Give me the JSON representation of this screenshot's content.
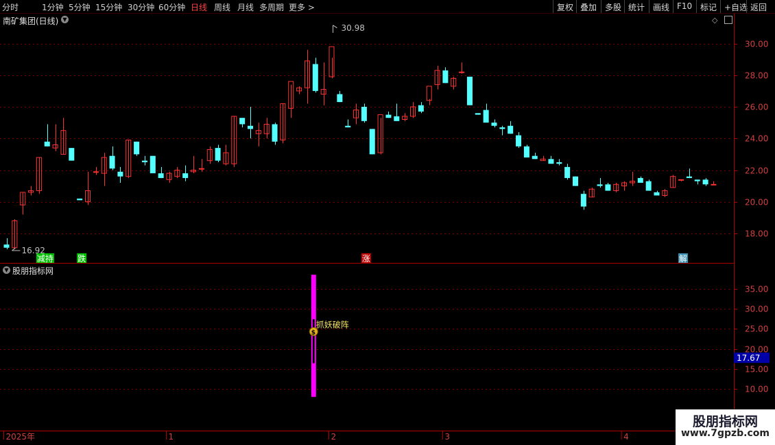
{
  "toolbar": {
    "periods": [
      {
        "label": "分时",
        "active": false
      },
      {
        "label": "1分钟",
        "active": false
      },
      {
        "label": "5分钟",
        "active": false
      },
      {
        "label": "15分钟",
        "active": false
      },
      {
        "label": "30分钟",
        "active": false
      },
      {
        "label": "60分钟",
        "active": false
      },
      {
        "label": "日线",
        "active": true
      },
      {
        "label": "周线",
        "active": false
      },
      {
        "label": "月线",
        "active": false
      },
      {
        "label": "多周期",
        "active": false
      },
      {
        "label": "更多 >",
        "active": false
      }
    ],
    "actions": [
      "复权",
      "叠加",
      "多股",
      "统计",
      "画线",
      "F10",
      "标记",
      "+自选",
      "返回"
    ]
  },
  "main_panel": {
    "title": "南矿集团(日线)",
    "high_label": "30.98",
    "low_label": "16.92",
    "signals": [
      {
        "text": "减持",
        "color": "#00c000",
        "bar": 4
      },
      {
        "text": "跌",
        "color": "#00c000",
        "bar": 9
      },
      {
        "text": "涨",
        "color": "#c00000",
        "bar": 44
      },
      {
        "text": "解",
        "color": "#3a8fb0",
        "bar": 83
      }
    ]
  },
  "indicator_panel": {
    "title": "股朋指标网",
    "signal_label": "抓妖破阵",
    "signal_badge": "$",
    "current_value": "17.67"
  },
  "time_axis": {
    "labels": [
      {
        "text": "2025年",
        "bar": 0
      },
      {
        "text": "1",
        "bar": 20
      },
      {
        "text": "2",
        "bar": 40
      },
      {
        "text": "3",
        "bar": 54
      },
      {
        "text": "4",
        "bar": 76
      }
    ]
  },
  "watermark": {
    "title": "股朋指标网",
    "url": "www.7gpzb.com"
  },
  "colors": {
    "up": "#ff3232",
    "down": "#54ffff",
    "axis": "#b00000",
    "grid": "#7a0000",
    "indicator": "#ff00ff"
  },
  "chart_data": [
    {
      "type": "candlestick",
      "title": "南矿集团(日线)",
      "y_ticks": [
        18.0,
        20.0,
        22.0,
        24.0,
        26.0,
        28.0,
        30.0
      ],
      "ylim": [
        16.4,
        31.9
      ],
      "ohlc": [
        [
          17.3,
          17.7,
          17.0,
          17.1
        ],
        [
          17.1,
          18.9,
          17.0,
          18.8
        ],
        [
          19.8,
          20.6,
          19.2,
          20.6
        ],
        [
          20.6,
          21.0,
          20.4,
          20.7
        ],
        [
          20.7,
          22.8,
          20.5,
          22.8
        ],
        [
          23.8,
          24.9,
          23.5,
          23.5
        ],
        [
          23.4,
          24.9,
          23.2,
          23.6
        ],
        [
          23.0,
          25.3,
          23.0,
          24.5
        ],
        [
          23.4,
          23.4,
          22.6,
          22.6
        ],
        [
          20.2,
          20.2,
          20.1,
          20.1
        ],
        [
          20.0,
          21.9,
          19.8,
          20.7
        ],
        [
          21.9,
          22.2,
          21.7,
          21.9
        ],
        [
          21.8,
          23.1,
          21.0,
          22.8
        ],
        [
          22.9,
          23.5,
          22.0,
          22.1
        ],
        [
          21.9,
          22.2,
          21.2,
          21.6
        ],
        [
          21.6,
          23.9,
          21.5,
          23.9
        ],
        [
          23.8,
          23.8,
          22.9,
          23.0
        ],
        [
          22.6,
          22.9,
          22.3,
          22.5
        ],
        [
          22.9,
          22.9,
          21.9,
          21.8
        ],
        [
          21.8,
          22.2,
          21.5,
          21.5
        ],
        [
          21.4,
          21.9,
          21.2,
          21.8
        ],
        [
          21.6,
          22.2,
          21.5,
          22.0
        ],
        [
          21.8,
          22.3,
          21.3,
          21.5
        ],
        [
          21.9,
          22.9,
          21.8,
          22.0
        ],
        [
          22.1,
          22.7,
          21.9,
          22.1
        ],
        [
          22.6,
          23.5,
          22.4,
          23.3
        ],
        [
          23.4,
          23.6,
          22.5,
          22.6
        ],
        [
          22.4,
          23.6,
          22.3,
          23.1
        ],
        [
          22.4,
          25.4,
          22.2,
          25.4
        ],
        [
          25.3,
          25.3,
          24.7,
          24.9
        ],
        [
          24.8,
          26.0,
          24.0,
          24.6
        ],
        [
          24.3,
          25.0,
          23.5,
          24.5
        ],
        [
          24.3,
          25.3,
          24.0,
          24.9
        ],
        [
          24.9,
          25.0,
          23.6,
          23.8
        ],
        [
          23.9,
          26.2,
          23.7,
          26.2
        ],
        [
          25.9,
          27.4,
          25.3,
          27.6
        ],
        [
          27.0,
          27.3,
          26.8,
          27.2
        ],
        [
          27.2,
          29.6,
          26.2,
          28.9
        ],
        [
          28.7,
          29.1,
          26.9,
          27.0
        ],
        [
          26.8,
          28.8,
          26.1,
          27.1
        ],
        [
          27.9,
          29.1,
          27.8,
          29.8
        ],
        [
          26.8,
          27.0,
          26.3,
          26.3
        ],
        [
          24.8,
          25.2,
          24.7,
          24.7
        ],
        [
          25.3,
          26.2,
          24.9,
          25.8
        ],
        [
          26.0,
          26.2,
          25.0,
          25.1
        ],
        [
          24.6,
          24.6,
          23.0,
          23.0
        ],
        [
          23.1,
          25.3,
          23.0,
          25.5
        ],
        [
          25.5,
          25.7,
          25.3,
          25.3
        ],
        [
          25.4,
          26.2,
          25.1,
          25.1
        ],
        [
          25.2,
          25.6,
          25.1,
          25.4
        ],
        [
          25.4,
          26.3,
          25.3,
          26.0
        ],
        [
          26.1,
          26.3,
          25.6,
          25.7
        ],
        [
          26.4,
          26.5,
          26.1,
          27.3
        ],
        [
          27.4,
          28.6,
          27.1,
          28.3
        ],
        [
          28.3,
          28.5,
          27.5,
          27.5
        ],
        [
          27.3,
          27.9,
          27.1,
          27.8
        ],
        [
          28.2,
          28.8,
          28.1,
          28.2
        ],
        [
          27.9,
          27.9,
          26.1,
          26.1
        ],
        [
          25.6,
          25.6,
          25.5,
          25.5
        ],
        [
          25.8,
          26.2,
          25.6,
          25.0
        ],
        [
          25.0,
          25.2,
          24.7,
          24.8
        ],
        [
          24.7,
          24.8,
          24.2,
          24.6
        ],
        [
          24.8,
          25.1,
          24.3,
          24.3
        ],
        [
          24.2,
          24.4,
          23.4,
          23.5
        ],
        [
          23.5,
          23.6,
          22.8,
          22.8
        ],
        [
          22.9,
          23.1,
          22.7,
          22.7
        ],
        [
          22.6,
          22.9,
          22.6,
          22.7
        ],
        [
          22.7,
          22.9,
          22.5,
          22.4
        ],
        [
          22.5,
          22.7,
          22.3,
          22.4
        ],
        [
          22.2,
          22.4,
          21.4,
          21.5
        ],
        [
          21.6,
          21.6,
          21.0,
          21.0
        ],
        [
          20.5,
          20.7,
          19.5,
          19.7
        ],
        [
          20.3,
          20.9,
          20.3,
          20.8
        ],
        [
          21.1,
          21.5,
          20.9,
          21.0
        ],
        [
          21.1,
          21.2,
          20.7,
          20.7
        ],
        [
          20.7,
          21.2,
          20.6,
          21.1
        ],
        [
          21.0,
          21.3,
          20.7,
          21.2
        ],
        [
          21.2,
          21.9,
          21.0,
          21.3
        ],
        [
          21.5,
          21.6,
          21.2,
          21.2
        ],
        [
          21.3,
          21.4,
          20.7,
          20.7
        ],
        [
          20.6,
          20.7,
          20.5,
          20.4
        ],
        [
          20.4,
          20.8,
          20.3,
          20.7
        ],
        [
          20.9,
          21.7,
          20.9,
          21.6
        ],
        [
          21.4,
          21.4,
          21.3,
          21.4
        ],
        [
          21.6,
          22.1,
          21.5,
          21.5
        ],
        [
          21.4,
          21.4,
          21.1,
          21.3
        ],
        [
          21.4,
          21.5,
          21.0,
          21.1
        ],
        [
          21.1,
          21.3,
          21.1,
          21.1
        ]
      ]
    },
    {
      "type": "bar",
      "title": "股朋指标网",
      "y_ticks": [
        10.0,
        15.0,
        20.0,
        25.0,
        30.0,
        35.0
      ],
      "ylim": [
        5,
        40
      ],
      "bar_index": 38,
      "values": [
        {
          "low": 8.0,
          "high": 38.5
        }
      ],
      "hollow_segment": [
        16.3,
        27.5
      ],
      "current": 17.67
    }
  ]
}
